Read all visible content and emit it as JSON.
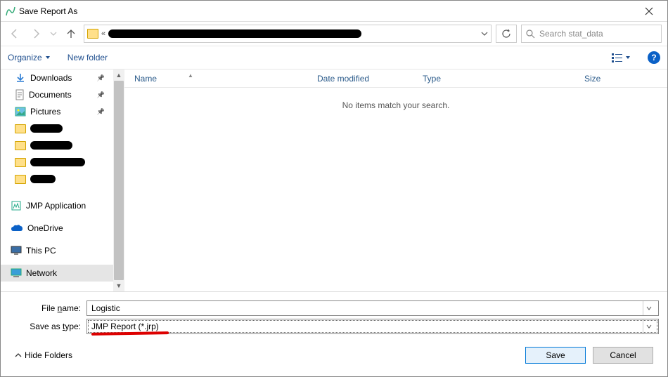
{
  "title": "Save Report As",
  "search": {
    "placeholder": "Search stat_data"
  },
  "toolbar": {
    "organize": "Organize",
    "newfolder": "New folder"
  },
  "sidebar": {
    "items": [
      {
        "label": "Downloads",
        "icon": "download",
        "pinned": true
      },
      {
        "label": "Documents",
        "icon": "document",
        "pinned": true
      },
      {
        "label": "Pictures",
        "icon": "pictures",
        "pinned": true
      },
      {
        "label": "",
        "icon": "folder",
        "redacted": true,
        "redactWidth": 46
      },
      {
        "label": "",
        "icon": "folder",
        "redacted": true,
        "redactWidth": 60
      },
      {
        "label": "",
        "icon": "folder",
        "redacted": true,
        "redactWidth": 78
      },
      {
        "label": "",
        "icon": "folder",
        "redacted": true,
        "redactWidth": 36
      },
      {
        "label": "JMP Application",
        "icon": "jmp"
      },
      {
        "label": "OneDrive",
        "icon": "onedrive"
      },
      {
        "label": "This PC",
        "icon": "pc"
      },
      {
        "label": "Network",
        "icon": "network",
        "selected": true
      }
    ]
  },
  "columns": {
    "name": "Name",
    "date": "Date modified",
    "type": "Type",
    "size": "Size"
  },
  "empty_text": "No items match your search.",
  "filename_label": "File name:",
  "filename_value": "Logistic",
  "saveastype_label": "Save as type:",
  "saveastype_value": "JMP Report (*.jrp)",
  "hide_folders": "Hide Folders",
  "save_btn": "Save",
  "cancel_btn": "Cancel"
}
